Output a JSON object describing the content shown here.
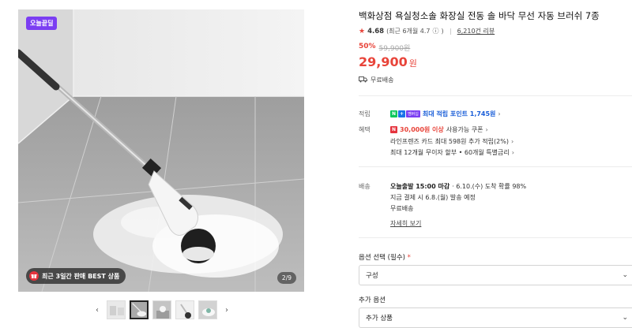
{
  "gallery": {
    "deal_badge": "오늘끝딜",
    "best_banner": "최근 3일간 판매 BEST 상품",
    "page_counter": "2/9",
    "prev_label": "‹",
    "next_label": "›"
  },
  "product": {
    "title": "백화상점 욕실청소솔 화장실 전동 솔 바닥 무선 자동 브러쉬 7종",
    "rating": "4.68",
    "rating_sub": "(최근 6개월 4.7",
    "rating_sub_end": ")",
    "review_count": "6,210건 리뷰",
    "discount_pct": "50%",
    "original_price": "59,900원",
    "price": "29,900",
    "price_unit": "원",
    "shipping": "무료배송"
  },
  "benefits": {
    "point_label": "적립",
    "point_text": "최대 적립 포인트 1,745원",
    "npay_n": "N",
    "npay_plus": "+",
    "npay_member": "멤버십",
    "benefit_label": "혜택",
    "coupon_amount": "30,000원 이상",
    "coupon_text": "사용가능 쿠폰",
    "card_text": "라인프렌즈 카드 최대 598원 추가 적립(2%)",
    "installment_text": "최대 12개월 무이자 할부 • 60개월 특별금리"
  },
  "delivery": {
    "label": "배송",
    "today_bold": "오늘출발 15:00 마감",
    "today_rest": "· 6.10.(수) 도착 확률 98%",
    "pay_now": "지금 결제 시 6.8.(월) 발송 예정",
    "fee": "무료배송",
    "detail_link": "자세히 보기"
  },
  "options": {
    "select_label": "옵션 선택 (필수)",
    "required_mark": "*",
    "select_value": "구성",
    "extra_label": "추가 옵션",
    "extra_value": "추가 상품"
  },
  "icons": {
    "star": "★",
    "chevron_right": "›",
    "chevron_down": "⌄",
    "info": "ⓘ"
  },
  "colors": {
    "accent_red": "#e8443a",
    "badge_purple": "#7b3ef2",
    "point_blue": "#1a5ed8",
    "npay_green": "#03c75a"
  }
}
